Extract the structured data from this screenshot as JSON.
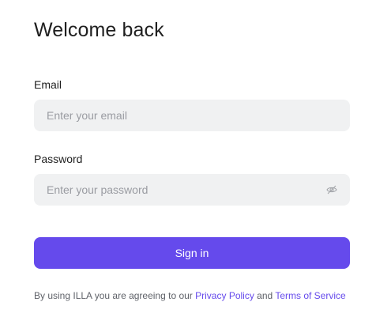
{
  "header": {
    "title": "Welcome back"
  },
  "form": {
    "email": {
      "label": "Email",
      "placeholder": "Enter your email",
      "value": ""
    },
    "password": {
      "label": "Password",
      "placeholder": "Enter your password",
      "value": "",
      "toggle_icon": "eye-icon"
    },
    "submit_label": "Sign in"
  },
  "footer": {
    "prefix": "By using ILLA you are agreeing to our ",
    "privacy_link": "Privacy Policy",
    "conjunction": " and ",
    "terms_link": "Terms of Service"
  },
  "colors": {
    "accent": "#654aec",
    "input_bg": "#f0f1f2",
    "placeholder": "#9a9ca2",
    "muted_text": "#5f6269"
  }
}
